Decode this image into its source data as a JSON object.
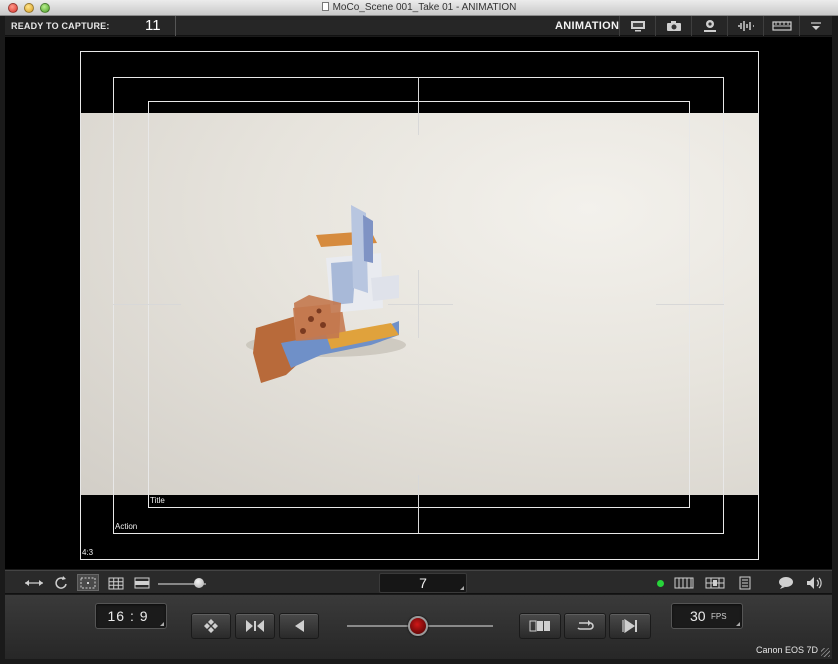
{
  "window": {
    "title": "MoCo_Scene 001_Take 01 - ANIMATION"
  },
  "toolbar": {
    "ready_label": "READY TO CAPTURE:",
    "frame_count": "11",
    "mode_label": "ANIMATION",
    "buttons": [
      "monitor-icon",
      "camera-icon",
      "webcam-icon",
      "audio-waveform-icon",
      "timeline-icon",
      "menu-arrow-icon"
    ]
  },
  "viewer": {
    "overlay_labels": {
      "title_safe": "Title",
      "action_safe": "Action",
      "aspect": "4:3"
    }
  },
  "strip": {
    "current_frame": "7",
    "icons_left": [
      "flip-horizontal-icon",
      "rotate-icon",
      "safe-area-icon",
      "grid-icon",
      "letterbox-icon",
      "zoom-slider"
    ],
    "icons_right": [
      "live-indicator",
      "filmstrip-icon",
      "onion-skin-icon",
      "list-icon",
      "comment-icon",
      "volume-icon"
    ],
    "zoom_level": 0.85,
    "live_indicator_color": "#27d43a"
  },
  "panel": {
    "aspect_ratio": "16 : 9",
    "fps_value": "30",
    "fps_unit": "FPS",
    "camera_name": "Canon EOS 7D",
    "transport": [
      "keypad-icon",
      "shutter-icon",
      "play-back-icon",
      "record-button",
      "compare-icon",
      "loop-icon",
      "skip-end-icon"
    ],
    "record_color": "#c01010"
  }
}
